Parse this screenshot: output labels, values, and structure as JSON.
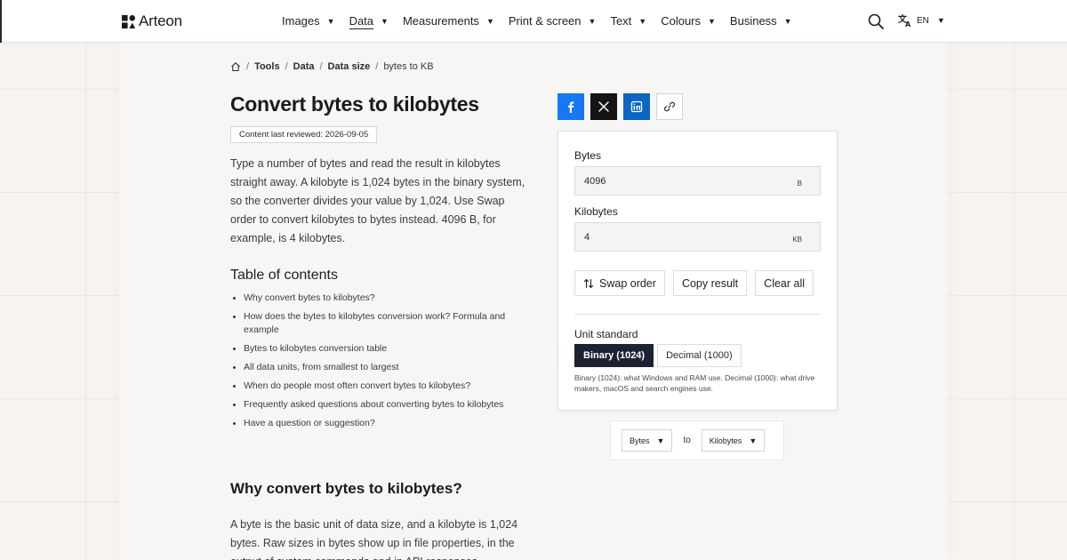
{
  "header": {
    "brand": "Arteon",
    "nav": [
      {
        "label": "Images",
        "active": false
      },
      {
        "label": "Data",
        "active": true
      },
      {
        "label": "Measurements",
        "active": false
      },
      {
        "label": "Print & screen",
        "active": false
      },
      {
        "label": "Text",
        "active": false
      },
      {
        "label": "Colours",
        "active": false
      },
      {
        "label": "Business",
        "active": false
      }
    ],
    "language": "EN",
    "icons": {
      "search": "search-icon",
      "language": "translate-icon",
      "home": "home-icon"
    }
  },
  "breadcrumb": {
    "items": [
      "Tools",
      "Data",
      "Data size"
    ],
    "current": "bytes to KB",
    "separator": "/"
  },
  "page": {
    "title": "Convert bytes to kilobytes",
    "review_badge": "Content last reviewed: 2026-09-05",
    "intro": "Type a number of bytes and read the result in kilobytes straight away. A kilobyte is 1,024 bytes in the binary system, so the converter divides your value by 1,024. Use Swap order to convert kilobytes to bytes instead. 4096 B, for example, is 4 kilobytes."
  },
  "toc": {
    "title": "Table of contents",
    "items": [
      "Why convert bytes to kilobytes?",
      "How does the bytes to kilobytes conversion work? Formula and example",
      "Bytes to kilobytes conversion table",
      "All data units, from smallest to largest",
      "When do people most often convert bytes to kilobytes?",
      "Frequently asked questions about converting bytes to kilobytes",
      "Have a question or suggestion?"
    ]
  },
  "section": {
    "heading": "Why convert bytes to kilobytes?",
    "text": "A byte is the basic unit of data size, and a kilobyte is 1,024 bytes. Raw sizes in bytes show up in file properties, in the output of system commands and in API responses."
  },
  "share": {
    "buttons": [
      "facebook-icon",
      "x-icon",
      "linkedin-icon",
      "link-icon"
    ],
    "colors": {
      "facebook": "#1877f2",
      "x": "#141414",
      "linkedin": "#0a66c2"
    }
  },
  "converter": {
    "from_label": "Bytes",
    "from_value": "4096",
    "from_unit": "B",
    "to_label": "Kilobytes",
    "to_value": "4",
    "to_unit": "KB",
    "swap_label": "Swap order",
    "copy_label": "Copy result",
    "clear_label": "Clear all",
    "unit_standard_label": "Unit standard",
    "binary_label": "Binary (1024)",
    "decimal_label": "Decimal (1000)",
    "selected_standard": "binary",
    "note": "Binary (1024): what Windows and RAM use. Decimal (1000): what drive makers, macOS and search engines use.",
    "selected_color": "#1d2233"
  },
  "unit_selector": {
    "from": "Bytes",
    "connector": "to",
    "to": "Kilobytes"
  }
}
